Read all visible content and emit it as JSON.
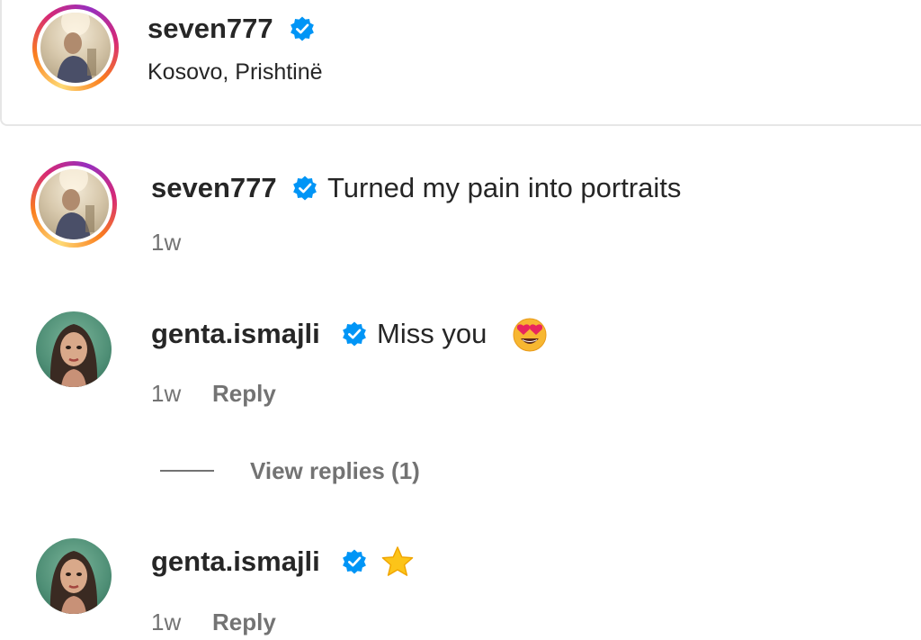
{
  "post_header": {
    "username": "seven777",
    "verified": true,
    "location": "Kosovo, Prishtinë"
  },
  "caption": {
    "username": "seven777",
    "verified": true,
    "text": "Turned my pain into portraits",
    "time": "1w"
  },
  "comments": [
    {
      "username": "genta.ismajli",
      "verified": true,
      "text": "Miss you",
      "emoji": "heart-eyes-emoji",
      "time": "1w",
      "reply_label": "Reply",
      "view_replies_label": "View replies (1)"
    },
    {
      "username": "genta.ismajli",
      "verified": true,
      "text": "",
      "emoji": "star-emoji",
      "time": "1w",
      "reply_label": "Reply"
    }
  ],
  "colors": {
    "verified_badge": "#0095f6",
    "secondary_text": "#737373",
    "primary_text": "#262626",
    "story_ring": [
      "#feda75",
      "#fa7e1e",
      "#d62976",
      "#962fbf"
    ]
  }
}
